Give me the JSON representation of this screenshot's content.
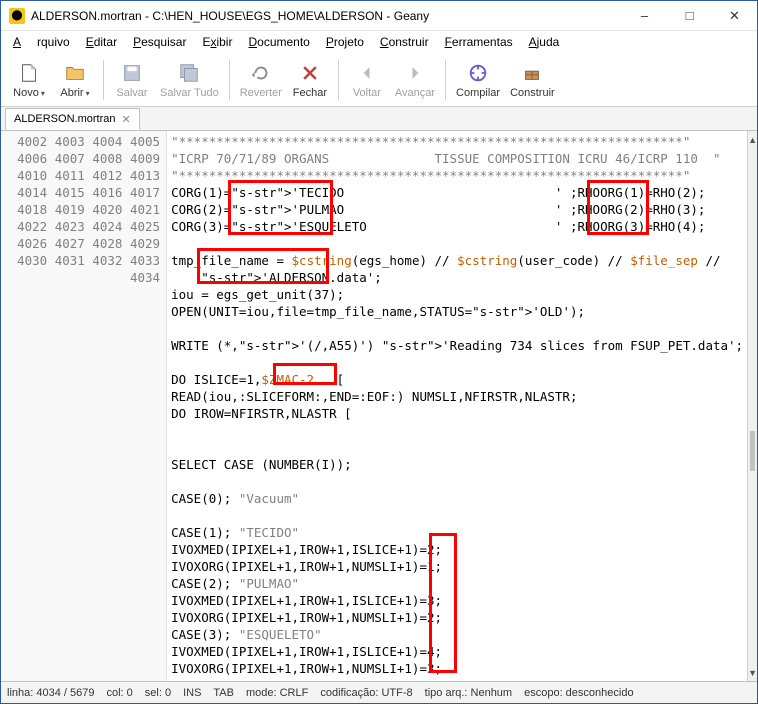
{
  "title": "ALDERSON.mortran - C:\\HEN_HOUSE\\EGS_HOME\\ALDERSON - Geany",
  "menus": [
    "Arquivo",
    "Editar",
    "Pesquisar",
    "Exibir",
    "Documento",
    "Projeto",
    "Construir",
    "Ferramentas",
    "Ajuda"
  ],
  "toolbar": {
    "novo": "Novo",
    "abrir": "Abrir",
    "salvar": "Salvar",
    "salvar_tudo": "Salvar Tudo",
    "reverter": "Reverter",
    "fechar": "Fechar",
    "voltar": "Voltar",
    "avancar": "Avançar",
    "compilar": "Compilar",
    "construir": "Construir"
  },
  "tab": {
    "name": "ALDERSON.mortran"
  },
  "gutter_start": 4002,
  "gutter_end": 4034,
  "code_lines": [
    "\"*******************************************************************\"",
    "\"ICRP 70/71/89 ORGANS              TISSUE COMPOSITION ICRU 46/ICRP 110  \"",
    "\"*******************************************************************\"",
    "CORG(1)='TECIDO                            ' ;RHOORG(1)=RHO(2);",
    "CORG(2)='PULMAO                            ' ;RHOORG(2)=RHO(3);",
    "CORG(3)='ESQUELETO                         ' ;RHOORG(3)=RHO(4);",
    "",
    "tmp_file_name = $cstring(egs_home) // $cstring(user_code) // $file_sep //",
    "    'ALDERSON.data';",
    "iou = egs_get_unit(37);",
    "OPEN(UNIT=iou,file=tmp_file_name,STATUS='OLD');",
    "",
    "WRITE (*,'(/,A55)') 'Reading 734 slices from FSUP_PET.data';",
    "",
    "DO ISLICE=1,$ZMAC-2   [",
    "READ(iou,:SLICEFORM:,END=:EOF:) NUMSLI,NFIRSTR,NLASTR;",
    "DO IROW=NFIRSTR,NLASTR [",
    "",
    "",
    "SELECT CASE (NUMBER(I));",
    "",
    "CASE(0); \"Vacuum\"",
    "",
    "CASE(1); \"TECIDO\"",
    "IVOXMED(IPIXEL+1,IROW+1,ISLICE+1)=2;",
    "IVOXORG(IPIXEL+1,IROW+1,NUMSLI+1)=1;",
    "CASE(2); \"PULMAO\"",
    "IVOXMED(IPIXEL+1,IROW+1,ISLICE+1)=3;",
    "IVOXORG(IPIXEL+1,IROW+1,NUMSLI+1)=2;",
    "CASE(3); \"ESQUELETO\"",
    "IVOXMED(IPIXEL+1,IROW+1,ISLICE+1)=4;",
    "IVOXORG(IPIXEL+1,IROW+1,NUMSLI+1)=3;",
    ""
  ],
  "status": {
    "linha": "linha: 4034 / 5679",
    "col": "col: 0",
    "sel": "sel: 0",
    "ins": "INS",
    "tab": "TAB",
    "mode": "mode: CRLF",
    "enc": "codificação: UTF-8",
    "ftype": "tipo arq.: Nenhum",
    "scope": "escopo: desconhecido"
  }
}
